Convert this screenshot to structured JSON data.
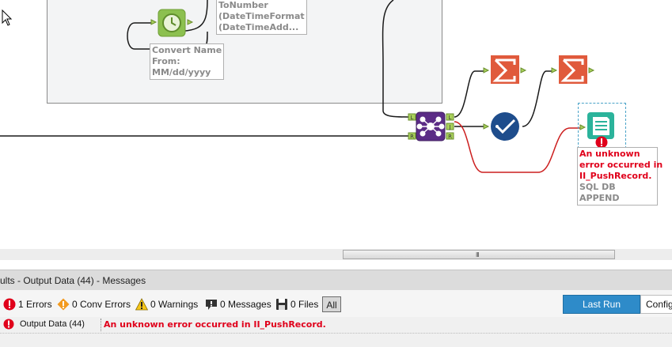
{
  "canvas": {
    "container_label": "ToNumber\n(DateTimeFormat\n(DateTimeAdd...",
    "datetime_tool_label": "Convert Name\nFrom:\nMM/dd/yyyy",
    "join_anchors": {
      "left": "L",
      "right": "R",
      "out_left": "L",
      "out_join": "J",
      "out_right": "R"
    },
    "output_tool": {
      "error_label": "An unknown\nerror occurred in\nII_PushRecord.",
      "name_label": "SQL DB APPEND"
    }
  },
  "scrollbar": {
    "grip": "III"
  },
  "results_panel": {
    "title": "ults - Output Data (44) - Messages",
    "toolbar": {
      "errors": "1 Errors",
      "conv_errors": "0 Conv Errors",
      "warnings": "0 Warnings",
      "messages": "0 Messages",
      "files": "0 Files",
      "all": "All",
      "last_run": "Last Run",
      "config": "Config"
    },
    "messages": [
      {
        "source": "Output Data (44)",
        "text": "An unknown error occurred in II_PushRecord."
      }
    ]
  },
  "colors": {
    "summarize": "#e05a3c",
    "join": "#5b2c86",
    "test": "#1e4d8c",
    "output": "#2bb39b",
    "error": "#e0001b",
    "wire_red": "#cc1e1e",
    "anchor_green": "#a8d05a",
    "accent_blue": "#2e8bc9"
  }
}
